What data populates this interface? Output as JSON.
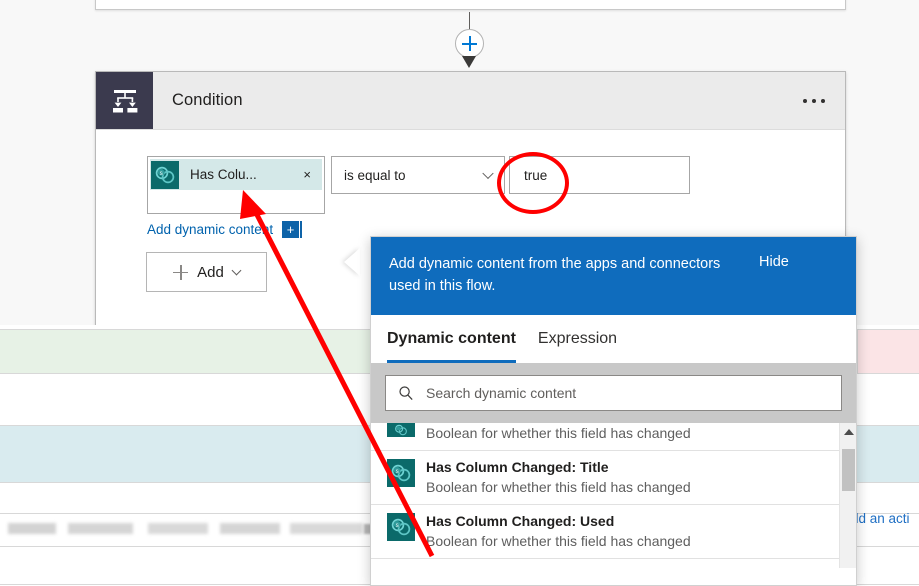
{
  "canvas": {
    "connector": {
      "plus_icon": "plus-circle-icon",
      "arrow_icon": "down-arrow-icon"
    }
  },
  "condition_card": {
    "icon": "condition-branch-icon",
    "title": "Condition",
    "menu": "ellipsis-icon",
    "condition_row": {
      "token": {
        "icon": "sharepoint-icon",
        "label": "Has Colu...",
        "remove": "×"
      },
      "operator": {
        "value": "is equal to",
        "chevron": "chevron-down-icon"
      },
      "value": {
        "text": "true"
      }
    },
    "add_dynamic_content": {
      "label": "Add dynamic content",
      "badge": "+"
    },
    "add_button": {
      "label": "Add",
      "plus": "plus-icon",
      "chevron": "chevron-down-icon"
    }
  },
  "dynamic_content_panel": {
    "banner": {
      "text": "Add dynamic content from the apps and connectors used in this flow.",
      "hide_label": "Hide"
    },
    "tabs": [
      {
        "label": "Dynamic content",
        "active": true
      },
      {
        "label": "Expression",
        "active": false
      }
    ],
    "search": {
      "placeholder": "Search dynamic content",
      "icon": "search-icon",
      "value": ""
    },
    "items": [
      {
        "icon": "sharepoint-icon",
        "title": "",
        "desc": "Boolean for whether this field has changed",
        "partial": true
      },
      {
        "icon": "sharepoint-icon",
        "title": "Has Column Changed: Title",
        "desc": "Boolean for whether this field has changed",
        "partial": false
      },
      {
        "icon": "sharepoint-icon",
        "title": "Has Column Changed: Used",
        "desc": "Boolean for whether this field has changed",
        "partial": false
      }
    ],
    "scrollbar": {
      "up_arrow": "scroll-up-arrow-icon"
    }
  },
  "background": {
    "add_action_label": "dd an acti"
  },
  "annotations": {
    "circle_target": "true",
    "arrow_target": "Has Colu... token",
    "color": "#ff0000"
  }
}
